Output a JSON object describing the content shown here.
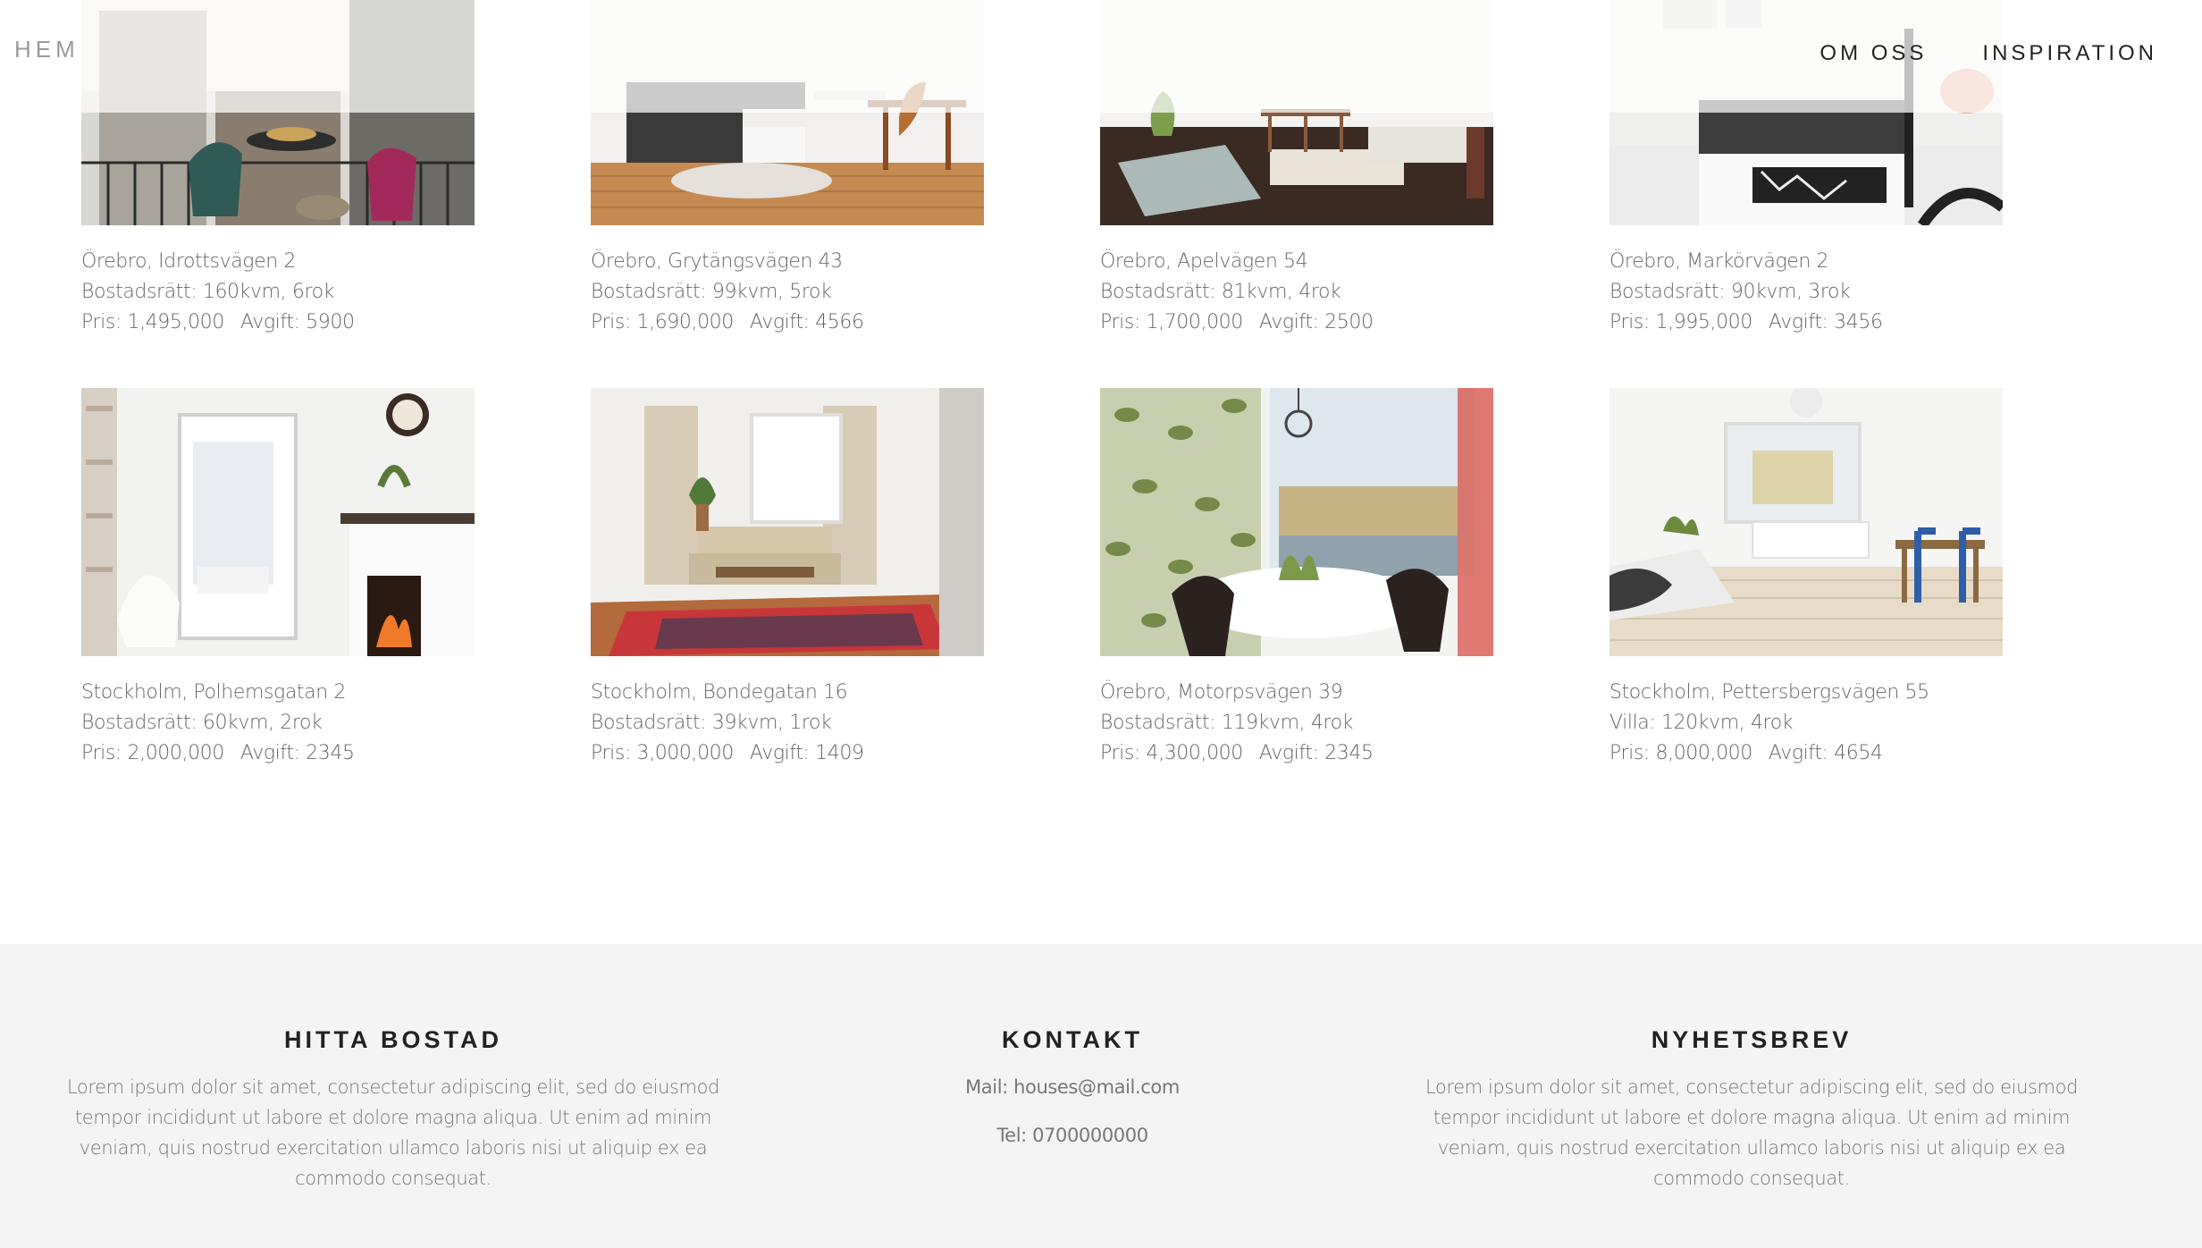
{
  "nav": {
    "brand": "HEM",
    "links": [
      "OM OSS",
      "INSPIRATION"
    ]
  },
  "listings": [
    {
      "location": "Örebro, Idrottsvägen 2",
      "details": "Bostadsrätt: 160kvm, 6rok",
      "price": "Pris: 1,495,000",
      "fee": "Avgift: 5900",
      "image": "balcony-photo"
    },
    {
      "location": "Örebro, Grytängsvägen 43",
      "details": "Bostadsrätt: 99kvm, 5rok",
      "price": "Pris: 1,690,000",
      "fee": "Avgift: 4566",
      "image": "living-room-photo"
    },
    {
      "location": "Örebro, Apelvägen 54",
      "details": "Bostadsrätt: 81kvm, 4rok",
      "price": "Pris: 1,700,000",
      "fee": "Avgift: 2500",
      "image": "dining-room-photo"
    },
    {
      "location": "Örebro, Markörvägen 2",
      "details": "Bostadsrätt: 90kvm, 3rok",
      "price": "Pris: 1,995,000",
      "fee": "Avgift: 3456",
      "image": "sofa-photo"
    },
    {
      "location": "Stockholm, Polhemsgatan 2",
      "details": "Bostadsrätt: 60kvm, 2rok",
      "price": "Pris: 2,000,000",
      "fee": "Avgift: 2345",
      "image": "fireplace-photo"
    },
    {
      "location": "Stockholm, Bondegatan 16",
      "details": "Bostadsrätt: 39kvm, 1rok",
      "price": "Pris: 3,000,000",
      "fee": "Avgift: 1409",
      "image": "rug-living-room-photo"
    },
    {
      "location": "Örebro, Motorpsvägen 39",
      "details": "Bostadsrätt: 119kvm, 4rok",
      "price": "Pris: 4,300,000",
      "fee": "Avgift: 2345",
      "image": "dining-window-photo"
    },
    {
      "location": "Stockholm, Pettersbergsvägen 55",
      "details": "Villa: 120kvm, 4rok",
      "price": "Pris: 8,000,000",
      "fee": "Avgift: 4654",
      "image": "bright-room-photo"
    }
  ],
  "footer": {
    "find": {
      "title": "HITTA BOSTAD",
      "lines": [
        "Lorem ipsum dolor sit amet, consectetur adipiscing elit, sed do eiusmod",
        "tempor incididunt ut labore et dolore magna aliqua. Ut enim ad minim",
        "veniam, quis nostrud exercitation ullamco laboris nisi ut aliquip ex ea",
        "commodo consequat."
      ]
    },
    "contact": {
      "title": "KONTAKT",
      "mail": "Mail: houses@mail.com",
      "tel": "Tel: 0700000000"
    },
    "newsletter": {
      "title": "NYHETSBREV",
      "lines": [
        "Lorem ipsum dolor sit amet, consectetur adipiscing elit, sed do eiusmod",
        "tempor incididunt ut labore et dolore magna aliqua. Ut enim ad minim",
        "veniam, quis nostrud exercitation ullamco laboris nisi ut aliquip ex ea",
        "commodo consequat."
      ]
    }
  },
  "colors": {
    "footer_bg": "#f4f4f4",
    "text": "#666666",
    "heading": "#222222"
  }
}
